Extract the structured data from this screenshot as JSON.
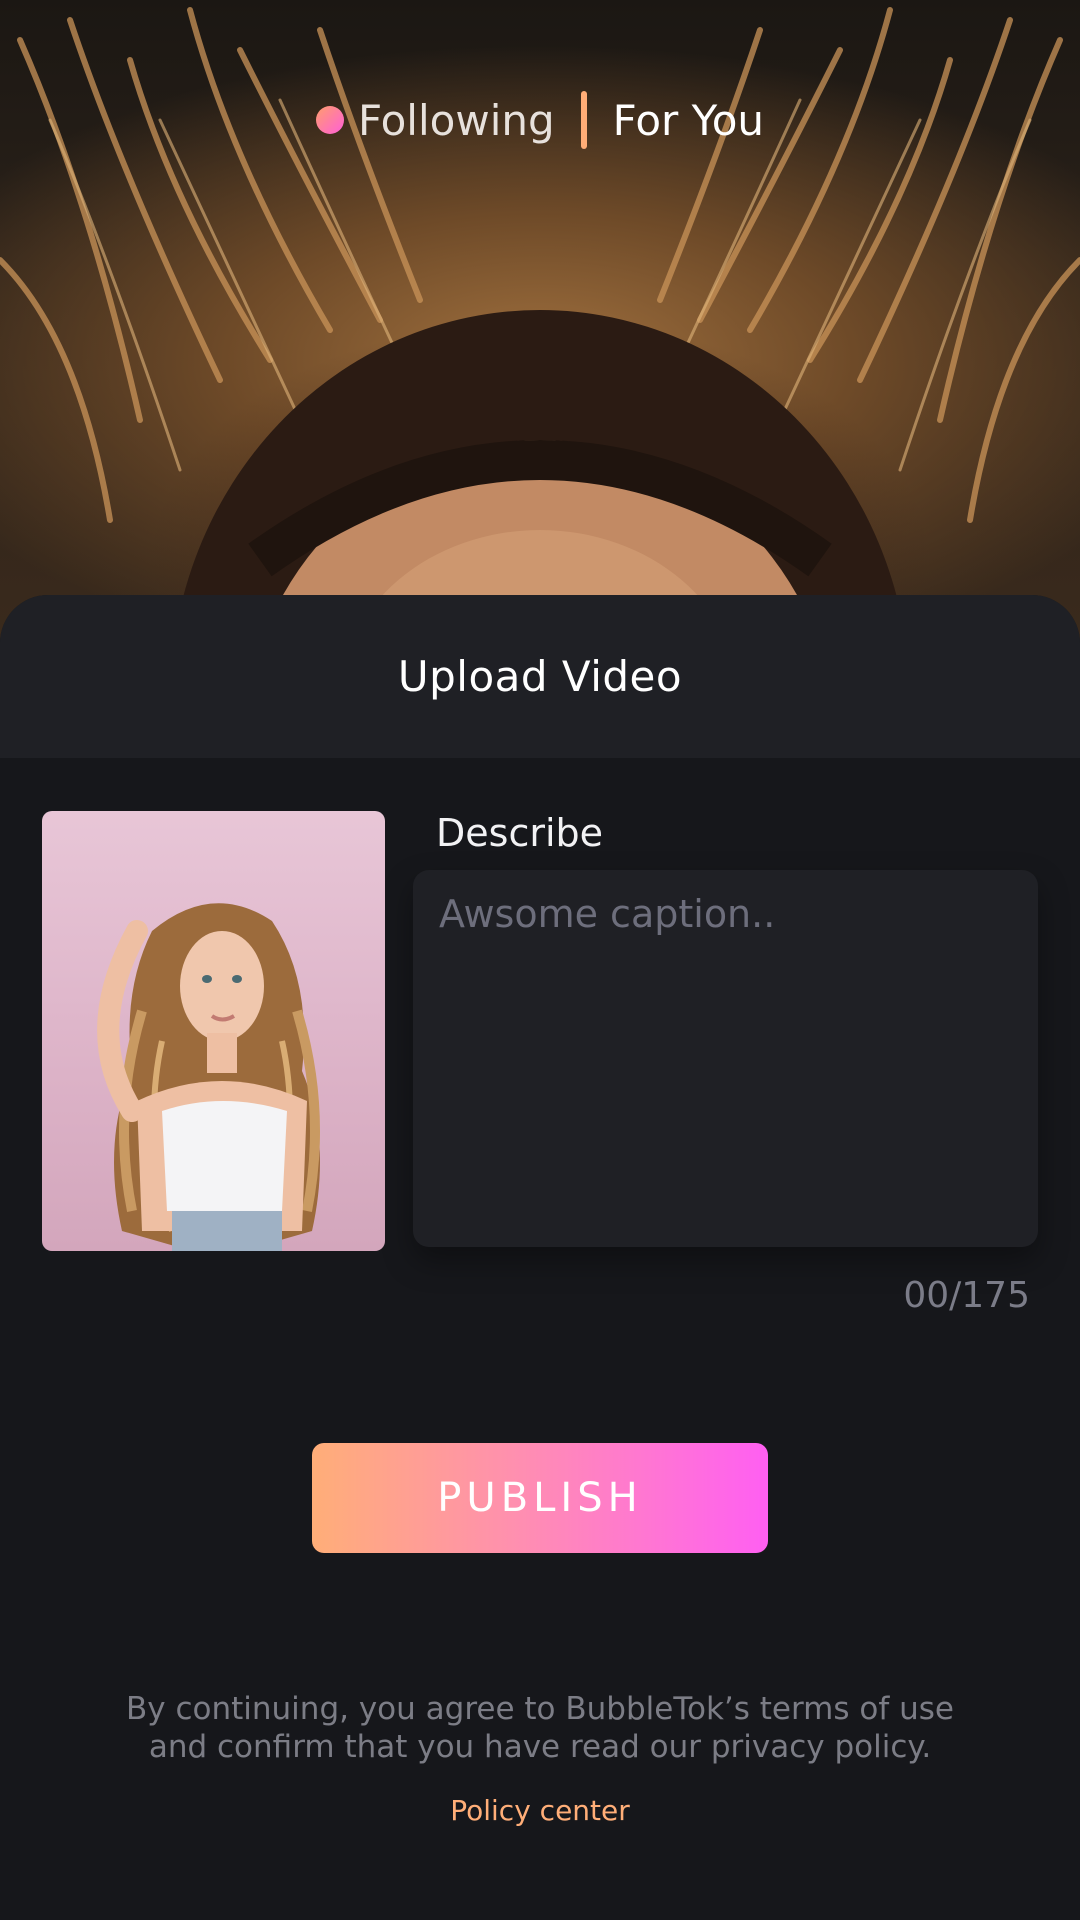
{
  "top_tabs": {
    "following_label": "Following",
    "for_you_label": "For You"
  },
  "sheet": {
    "title": "Upload Video"
  },
  "upload": {
    "describe_label": "Describe",
    "caption_placeholder": "Awsome caption..",
    "caption_value": "",
    "char_count": "00/175"
  },
  "actions": {
    "publish_label": "PUBLISH"
  },
  "footer": {
    "terms_line1": "By continuing, you agree to BubbleTok’s terms of use",
    "terms_line2": "and confirm that you have read our privacy policy.",
    "policy_link": "Policy center"
  },
  "colors": {
    "accent_orange": "#ffae78",
    "accent_pink": "#ff5ff2",
    "sheet_background": "#16171b",
    "header_background": "#1f2025",
    "input_background": "#1f2025",
    "muted_text": "#7c7d86"
  },
  "icons": {
    "live_dot": "live-indicator-dot"
  }
}
